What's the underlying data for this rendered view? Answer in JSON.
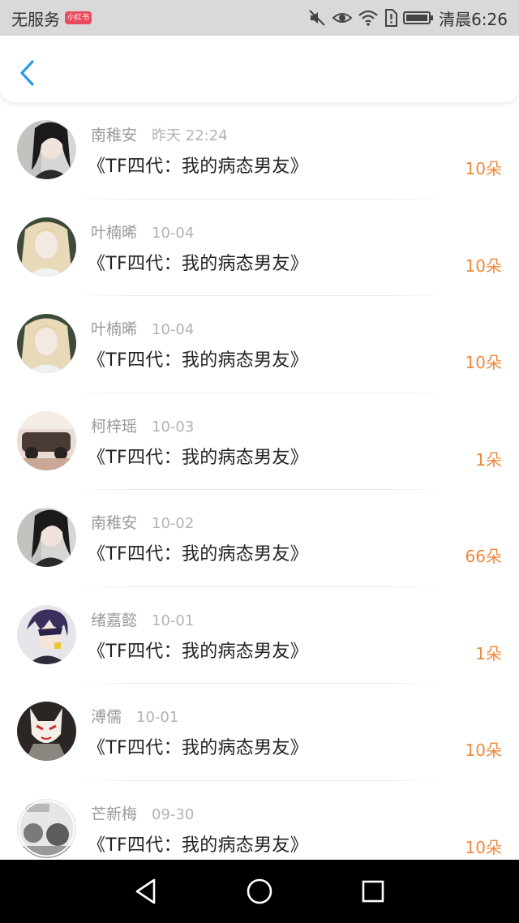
{
  "status_bar": {
    "carrier": "无服务",
    "carrier_badge": "小红书",
    "time": "清晨6:26",
    "icons": [
      "mute-icon",
      "eye-icon",
      "wifi-icon",
      "sim-alert-icon",
      "battery-icon"
    ]
  },
  "header": {
    "back_icon": "chevron-left-icon",
    "accent_color": "#2e9ae6"
  },
  "colors": {
    "count_color": "#f0883c",
    "name_color": "#9a9a9a",
    "time_color": "#b3b3b3"
  },
  "items": [
    {
      "name": "南稚安",
      "time": "昨天 22:24",
      "title": "《TF四代：我的病态男友》",
      "count": "10朵",
      "avatar": "girl-dark-hair"
    },
    {
      "name": "叶楠晞",
      "time": "10-04",
      "title": "《TF四代：我的病态男友》",
      "count": "10朵",
      "avatar": "girl-blonde"
    },
    {
      "name": "叶楠晞",
      "time": "10-04",
      "title": "《TF四代：我的病态男友》",
      "count": "10朵",
      "avatar": "girl-blonde"
    },
    {
      "name": "柯梓瑶",
      "time": "10-03",
      "title": "《TF四代：我的病态男友》",
      "count": "1朵",
      "avatar": "car-photo"
    },
    {
      "name": "南稚安",
      "time": "10-02",
      "title": "《TF四代：我的病态男友》",
      "count": "66朵",
      "avatar": "girl-dark-hair"
    },
    {
      "name": "绪嘉懿",
      "time": "10-01",
      "title": "《TF四代：我的病态男友》",
      "count": "1朵",
      "avatar": "anime-boy"
    },
    {
      "name": "溥儒",
      "time": "10-01",
      "title": "《TF四代：我的病态男友》",
      "count": "10朵",
      "avatar": "fox-mask"
    },
    {
      "name": "芒新梅",
      "time": "09-30",
      "title": "《TF四代：我的病态男友》",
      "count": "10朵",
      "avatar": "street-photo"
    }
  ],
  "nav_bar": {
    "buttons": [
      "back-triangle-icon",
      "home-circle-icon",
      "recents-square-icon"
    ]
  }
}
